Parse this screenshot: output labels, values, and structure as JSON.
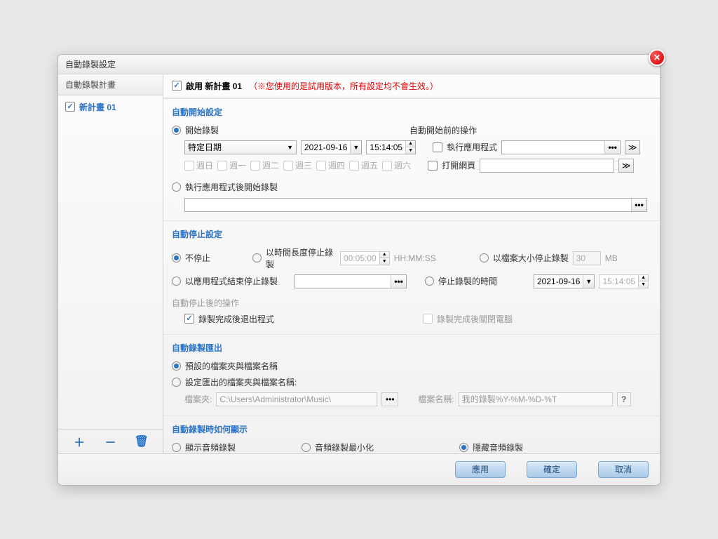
{
  "title": "自動錄製設定",
  "close_label": "✕",
  "sidebar": {
    "header": "自動錄製計畫",
    "plan_name": "新計畫 01",
    "add": "＋",
    "remove": "－",
    "delete": "🗑"
  },
  "enable": {
    "label": "啟用",
    "plan": "新計畫 01",
    "trial": "（※您使用的是試用版本，所有設定均不會生效。）"
  },
  "auto_start": {
    "title": "自動開始設定",
    "start_recording": "開始錄製",
    "before_op": "自動開始前的操作",
    "date_type": "特定日期",
    "date": "2021-09-16",
    "time": "15:14:05",
    "run_app": "執行應用程式",
    "open_web": "打開網頁",
    "after_app": "執行應用程式後開始錄製",
    "days": [
      "週日",
      "週一",
      "週二",
      "週三",
      "週四",
      "週五",
      "週六"
    ]
  },
  "auto_stop": {
    "title": "自動停止設定",
    "no_stop": "不停止",
    "by_duration": "以時間長度停止錄製",
    "duration": "00:05:00",
    "hms": "HH:MM:SS",
    "by_size": "以檔案大小停止錄製",
    "size": "30",
    "size_unit": "MB",
    "by_app_end": "以應用程式結束停止錄製",
    "stop_time": "停止錄製的時間",
    "stop_date": "2021-09-16",
    "stop_time_val": "15:14:05",
    "after_stop": "自動停止後的操作",
    "exit_after": "錄製完成後退出程式",
    "shutdown_after": "錄製完成後關閉電腦"
  },
  "export": {
    "title": "自動錄製匯出",
    "default": "預設的檔案夾與檔案名稱",
    "custom": "設定匯出的檔案夾與檔案名稱:",
    "folder_label": "檔案夾:",
    "folder": "C:\\Users\\Administrator\\Music\\",
    "name_label": "檔案名稱:",
    "name": "我的錄製%Y-%M-%D-%T",
    "help": "?"
  },
  "display": {
    "title": "自動錄製時如何顯示",
    "show": "顯示音頻錄製",
    "minimize": "音頻錄製最小化",
    "hide": "隱藏音頻錄製"
  },
  "buttons": {
    "apply": "應用",
    "ok": "確定",
    "cancel": "取消"
  }
}
